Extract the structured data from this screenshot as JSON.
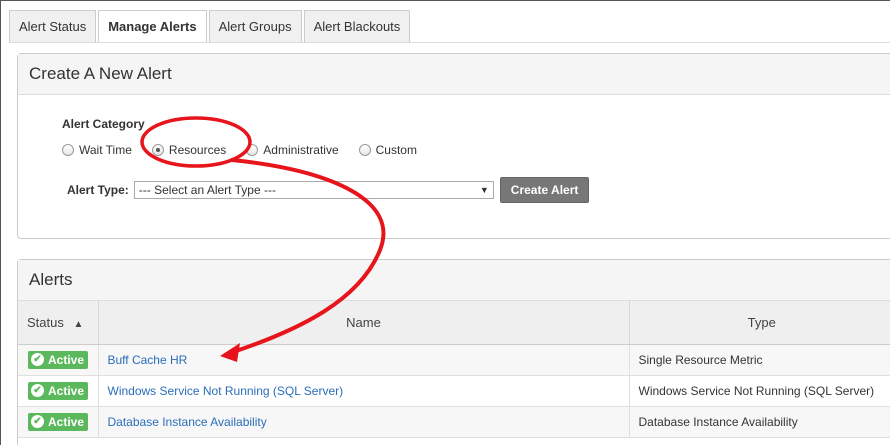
{
  "tabs": [
    {
      "label": "Alert Status",
      "active": false
    },
    {
      "label": "Manage Alerts",
      "active": true
    },
    {
      "label": "Alert Groups",
      "active": false
    },
    {
      "label": "Alert Blackouts",
      "active": false
    }
  ],
  "create_panel": {
    "title": "Create A New Alert",
    "category_label": "Alert Category",
    "categories": [
      {
        "label": "Wait Time",
        "checked": false
      },
      {
        "label": "Resources",
        "checked": true
      },
      {
        "label": "Administrative",
        "checked": false
      },
      {
        "label": "Custom",
        "checked": false
      }
    ],
    "type_label": "Alert Type:",
    "type_select_value": "--- Select an Alert Type ---",
    "create_button": "Create Alert"
  },
  "alerts_panel": {
    "title": "Alerts",
    "columns": {
      "status": "Status",
      "name": "Name",
      "type": "Type"
    },
    "sort_indicator": "▲",
    "rows": [
      {
        "status": "Active",
        "name": "Buff Cache HR",
        "type": "Single Resource Metric"
      },
      {
        "status": "Active",
        "name": "Windows Service Not Running (SQL Server)",
        "type": "Windows Service Not Running (SQL Server)"
      },
      {
        "status": "Active",
        "name": "Database Instance Availability",
        "type": "Database Instance Availability"
      }
    ]
  },
  "colors": {
    "accent_link": "#2a6ebb",
    "active_badge": "#5cb85c",
    "annotation": "#e8141b"
  }
}
